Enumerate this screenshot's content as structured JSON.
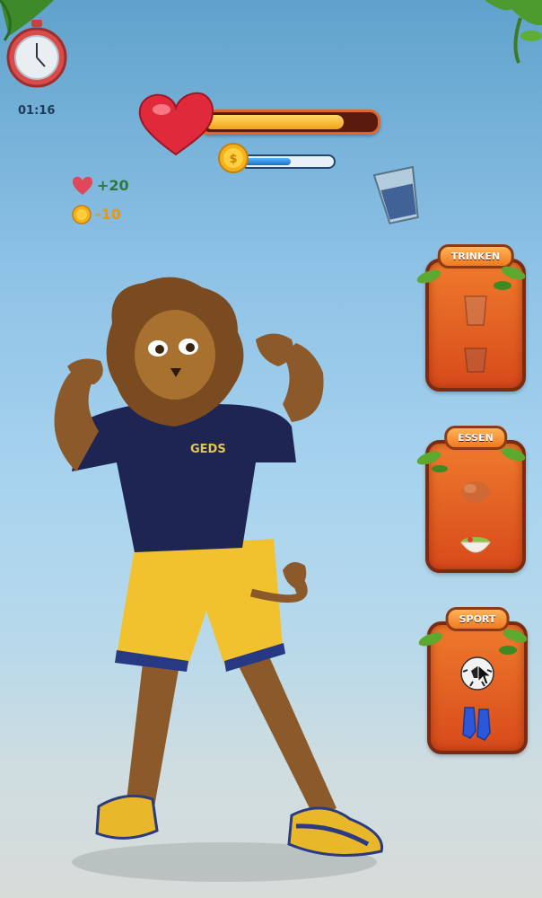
{
  "hud": {
    "timer": "01:16",
    "health_fill_fraction": 0.82,
    "coin_fill_fraction": 0.55
  },
  "stats": {
    "health_delta": "+20",
    "coin_delta": "-10"
  },
  "panels": [
    {
      "title": "TRINKEN",
      "items": [
        "water-glass-icon",
        "water-glass-icon"
      ]
    },
    {
      "title": "ESSEN",
      "items": [
        "chicken-icon",
        "salad-bowl-icon"
      ]
    },
    {
      "title": "SPORT",
      "items": [
        "soccer-ball-icon",
        "shin-guards-icon"
      ]
    }
  ],
  "character": {
    "shirt_logo": "GEDS"
  },
  "colors": {
    "health_bar": "#f0a318",
    "coin_bar": "#1872c6",
    "panel": "#e2601f",
    "panel_border": "#7a2b12"
  }
}
